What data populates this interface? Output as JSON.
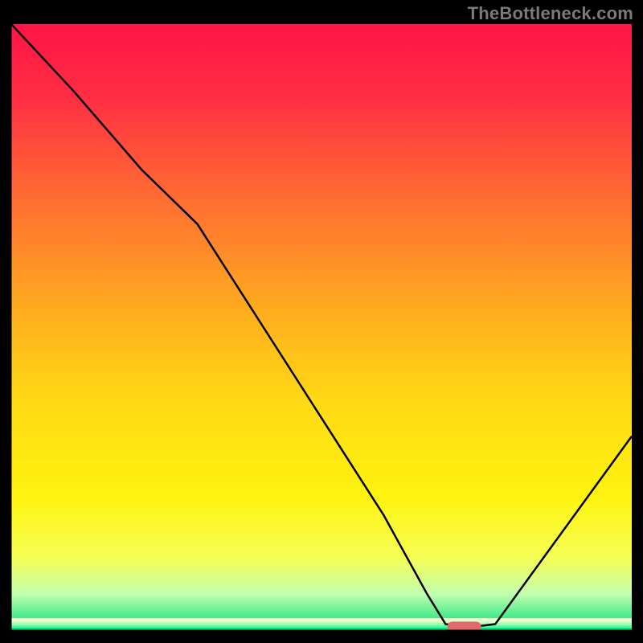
{
  "watermark": "TheBottleneck.com",
  "palette": {
    "gradient_stops": [
      {
        "offset": 0.0,
        "color": "#ff1447"
      },
      {
        "offset": 0.12,
        "color": "#ff2e43"
      },
      {
        "offset": 0.28,
        "color": "#ff6a33"
      },
      {
        "offset": 0.46,
        "color": "#ffa81f"
      },
      {
        "offset": 0.62,
        "color": "#ffd915"
      },
      {
        "offset": 0.78,
        "color": "#fff30f"
      },
      {
        "offset": 0.88,
        "color": "#f6ff55"
      },
      {
        "offset": 0.94,
        "color": "#c3ffae"
      },
      {
        "offset": 1.0,
        "color": "#00e07a"
      }
    ],
    "curve_stroke": "#000000",
    "marker_fill": "#e26a6f",
    "axis_stroke": "#000000"
  },
  "chart_data": {
    "type": "line",
    "title": "",
    "xlabel": "",
    "ylabel": "",
    "xlim": [
      0,
      100
    ],
    "ylim": [
      0,
      100
    ],
    "grid": false,
    "legend": false,
    "series": [
      {
        "name": "bottleneck-curve",
        "x": [
          0,
          10,
          21,
          30,
          40,
          50,
          60,
          67,
          70,
          74,
          78,
          100
        ],
        "y": [
          100,
          89,
          76,
          67,
          51,
          35,
          19,
          6,
          1,
          0.5,
          1,
          32
        ]
      }
    ],
    "marker": {
      "x": 73,
      "y": 0.6
    },
    "annotations": []
  }
}
